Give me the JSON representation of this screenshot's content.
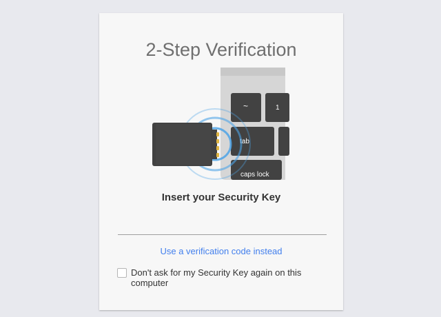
{
  "page": {
    "title": "2-Step Verification",
    "heading": "Insert your Security Key",
    "alt_link": "Use a verification code instead",
    "remember_label": "Don't ask for my Security Key again on this computer",
    "remember_checked": false
  },
  "illustration": {
    "keys": {
      "tilde": "~",
      "one": "1",
      "tab": "tab",
      "caps": "caps lock"
    }
  },
  "colors": {
    "background": "#e8e9ee",
    "card": "#f7f7f7",
    "title": "#6f6f6f",
    "link": "#427fed",
    "key": "#424242",
    "signal_ring": "#4da3e6",
    "usb_contact": "#e0b542"
  },
  "icons": [
    "security-key-icon",
    "laptop-keyboard-icon",
    "signal-rings-icon",
    "checkbox-icon"
  ]
}
